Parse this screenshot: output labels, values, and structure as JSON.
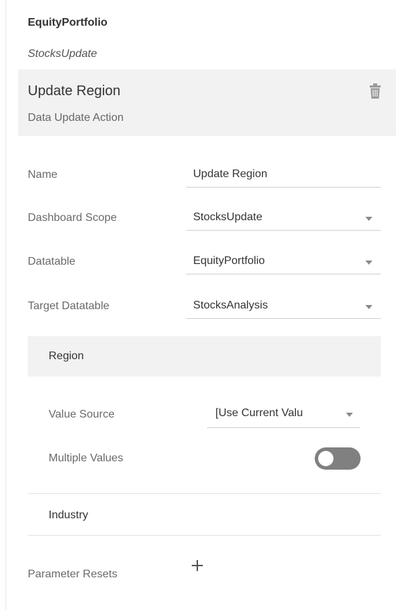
{
  "header": {
    "title": "EquityPortfolio",
    "subtitle": "StocksUpdate"
  },
  "action": {
    "title": "Update Region",
    "type": "Data Update Action",
    "delete_icon": "trash-icon"
  },
  "form": {
    "name": {
      "label": "Name",
      "value": "Update Region"
    },
    "dashboard_scope": {
      "label": "Dashboard Scope",
      "value": "StocksUpdate"
    },
    "datatable": {
      "label": "Datatable",
      "value": "EquityPortfolio"
    },
    "target_datatable": {
      "label": "Target Datatable",
      "value": "StocksAnalysis"
    }
  },
  "mappings": {
    "region": {
      "label": "Region",
      "value_source": {
        "label": "Value Source",
        "value": "[Use Current Valu"
      },
      "multiple_values": {
        "label": "Multiple Values",
        "on": false
      }
    },
    "industry": {
      "label": "Industry"
    }
  },
  "parameter_resets": {
    "label": "Parameter Resets",
    "add_icon": "plus-icon"
  },
  "colors": {
    "section_background": "#f2f2f2",
    "toggle_off": "#808080",
    "text_primary": "#333333",
    "text_muted": "#6a6a6a"
  }
}
